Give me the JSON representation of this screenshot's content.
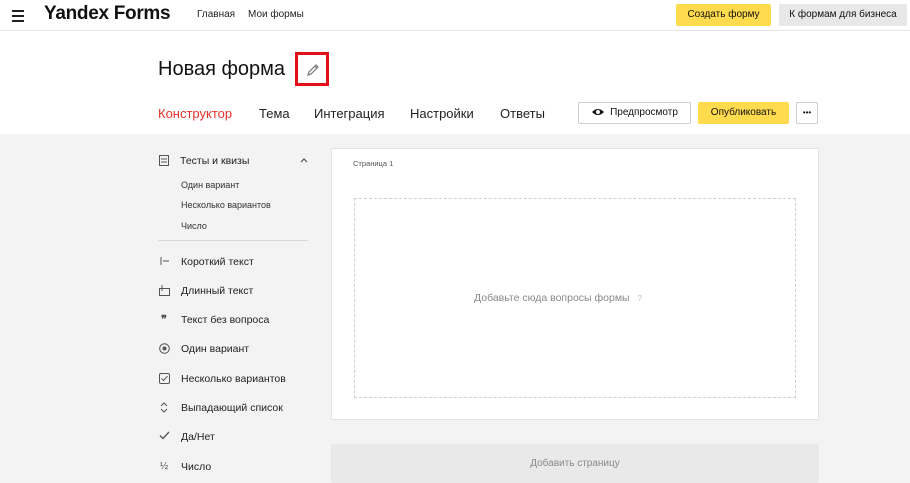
{
  "app": {
    "logo": "Yandex Forms",
    "nav": [
      {
        "label": "Главная"
      },
      {
        "label": "Мои формы"
      }
    ],
    "create_form_label": "Создать форму",
    "business_label": "К формам для бизнеса"
  },
  "form": {
    "title": "Новая форма",
    "tabs": [
      {
        "label": "Конструктор"
      },
      {
        "label": "Тема"
      },
      {
        "label": "Интеграция"
      },
      {
        "label": "Настройки"
      },
      {
        "label": "Ответы"
      }
    ],
    "preview_label": "Предпросмотр",
    "publish_label": "Опубликовать",
    "more_label": "•••"
  },
  "sidebar": {
    "group_title": "Тесты и квизы",
    "group_items": [
      "Один вариант",
      "Несколько вариантов",
      "Число"
    ],
    "items": [
      {
        "icon": "short-text-icon",
        "label": "Короткий текст"
      },
      {
        "icon": "long-text-icon",
        "label": "Длинный текст"
      },
      {
        "icon": "quote-icon",
        "label": "Текст без вопроса"
      },
      {
        "icon": "radio-icon",
        "label": "Один вариант"
      },
      {
        "icon": "checkbox-icon",
        "label": "Несколько вариантов"
      },
      {
        "icon": "dropdown-icon",
        "label": "Выпадающий список"
      },
      {
        "icon": "check-icon",
        "label": "Да/Нет"
      },
      {
        "icon": "number-icon",
        "label": "Число"
      }
    ]
  },
  "canvas": {
    "page_label": "Страница 1",
    "drop_text": "Добавьте сюда вопросы формы",
    "add_page_label": "Добавить страницу"
  },
  "colors": {
    "accent_yellow": "#ffdb4d",
    "active_tab": "#e4322b",
    "highlight_box": "#e3101b"
  }
}
